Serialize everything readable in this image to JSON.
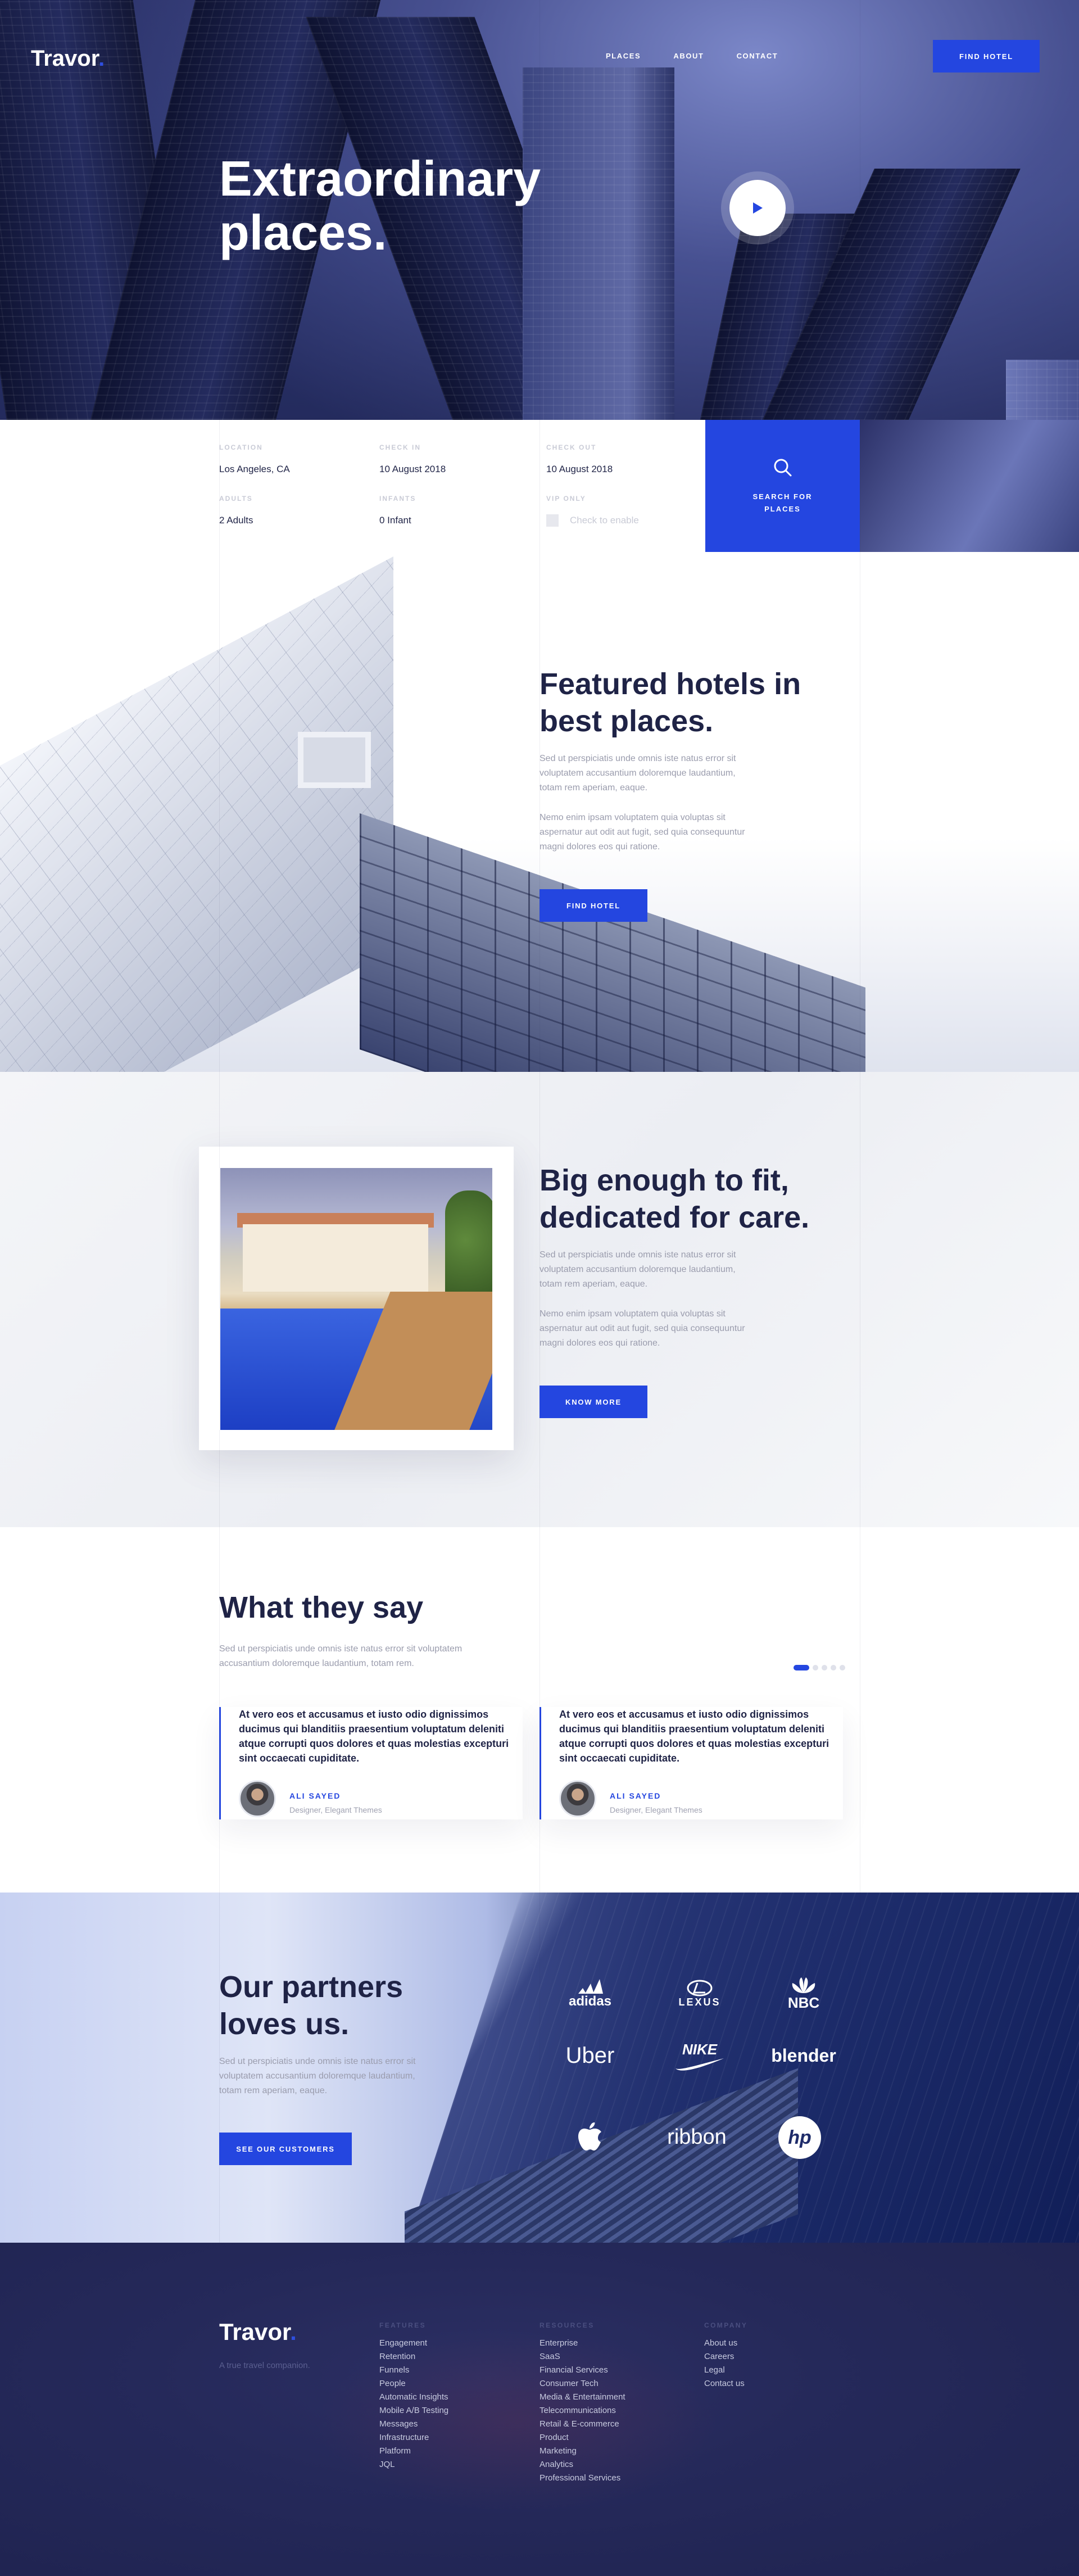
{
  "brand": {
    "name": "Travor",
    "dot": "."
  },
  "nav": {
    "items": [
      "PLACES",
      "ABOUT",
      "CONTACT"
    ],
    "cta": "FIND HOTEL"
  },
  "hero": {
    "title_line1": "Extraordinary",
    "title_line2": "places.",
    "play_icon": "play-icon"
  },
  "search": {
    "location_label": "LOCATION",
    "location_value": "Los Angeles, CA",
    "checkin_label": "CHECK IN",
    "checkin_value": "10 August 2018",
    "checkout_label": "CHECK OUT",
    "checkout_value": "10 August 2018",
    "adults_label": "ADULTS",
    "adults_value": "2 Adults",
    "infants_label": "INFANTS",
    "infants_value": "0 Infant",
    "vip_label": "VIP ONLY",
    "vip_checkbox_label": "Check to enable",
    "button_line1": "SEARCH FOR",
    "button_line2": "PLACES"
  },
  "featured": {
    "title_line1": "Featured hotels in",
    "title_line2": "best places.",
    "para1": [
      "Sed ut perspiciatis unde omnis iste natus error sit",
      "voluptatem accusantium doloremque laudantium,",
      "totam rem aperiam, eaque."
    ],
    "para2": [
      "Nemo enim ipsam voluptatem quia voluptas sit",
      "aspernatur aut odit aut fugit, sed quia consequuntur",
      "magni dolores eos qui ratione."
    ],
    "button": "FIND HOTEL"
  },
  "big_enough": {
    "title_line1": "Big enough to fit,",
    "title_line2": "dedicated for care.",
    "para1": [
      "Sed ut perspiciatis unde omnis iste natus error sit",
      "voluptatem accusantium doloremque laudantium,",
      "totam rem aperiam, eaque."
    ],
    "para2": [
      "Nemo enim ipsam voluptatem quia voluptas sit",
      "aspernatur aut odit aut fugit, sed quia consequuntur",
      "magni dolores eos qui ratione."
    ],
    "button": "KNOW MORE"
  },
  "testimonials": {
    "title": "What they say",
    "subtitle": [
      "Sed ut perspiciatis unde omnis iste natus error sit voluptatem",
      "accusantium doloremque laudantium, totam rem."
    ],
    "slider_dots": 5,
    "active_dot": 0,
    "items": [
      {
        "quote": "At vero eos et accusamus et iusto odio dignissimos ducimus qui blanditiis praesentium voluptatum deleniti atque corrupti quos dolores et quas molestias excepturi sint occaecati cupiditate.",
        "name": "ALI SAYED",
        "role": "Designer, Elegant Themes"
      },
      {
        "quote": "At vero eos et accusamus et iusto odio dignissimos ducimus qui blanditiis praesentium voluptatum deleniti atque corrupti quos dolores et quas molestias excepturi sint occaecati cupiditate.",
        "name": "ALI SAYED",
        "role": "Designer, Elegant Themes"
      }
    ]
  },
  "partners": {
    "title_line1": "Our partners",
    "title_line2": "loves us.",
    "para": [
      "Sed ut perspiciatis unde omnis iste natus error sit",
      "voluptatem accusantium doloremque laudantium,",
      "totam rem aperiam, eaque."
    ],
    "button": "SEE OUR CUSTOMERS",
    "logos": [
      "adidas",
      "LEXUS",
      "NBC",
      "Uber",
      "NIKE",
      "blender",
      "apple-logo",
      "ribbon",
      "hp"
    ]
  },
  "footer": {
    "tagline": "A true travel companion.",
    "features_title": "FEATURES",
    "features": [
      "Engagement",
      "Retention",
      "Funnels",
      "People",
      "Automatic Insights",
      "Mobile A/B Testing",
      "Messages",
      "Infrastructure",
      "Platform",
      "JQL"
    ],
    "resources_title": "RESOURCES",
    "resources": [
      "Enterprise",
      "SaaS",
      "Financial Services",
      "Consumer Tech",
      "Media & Entertainment",
      "Telecommunications",
      "Retail & E-commerce",
      "Product",
      "Marketing",
      "Analytics",
      "Professional Services"
    ],
    "company_title": "COMPANY",
    "company": [
      "About us",
      "Careers",
      "Legal",
      "Contact us"
    ]
  },
  "colors": {
    "accent": "#2446e0",
    "navy": "#1f2346",
    "muted": "#9a9cad"
  }
}
